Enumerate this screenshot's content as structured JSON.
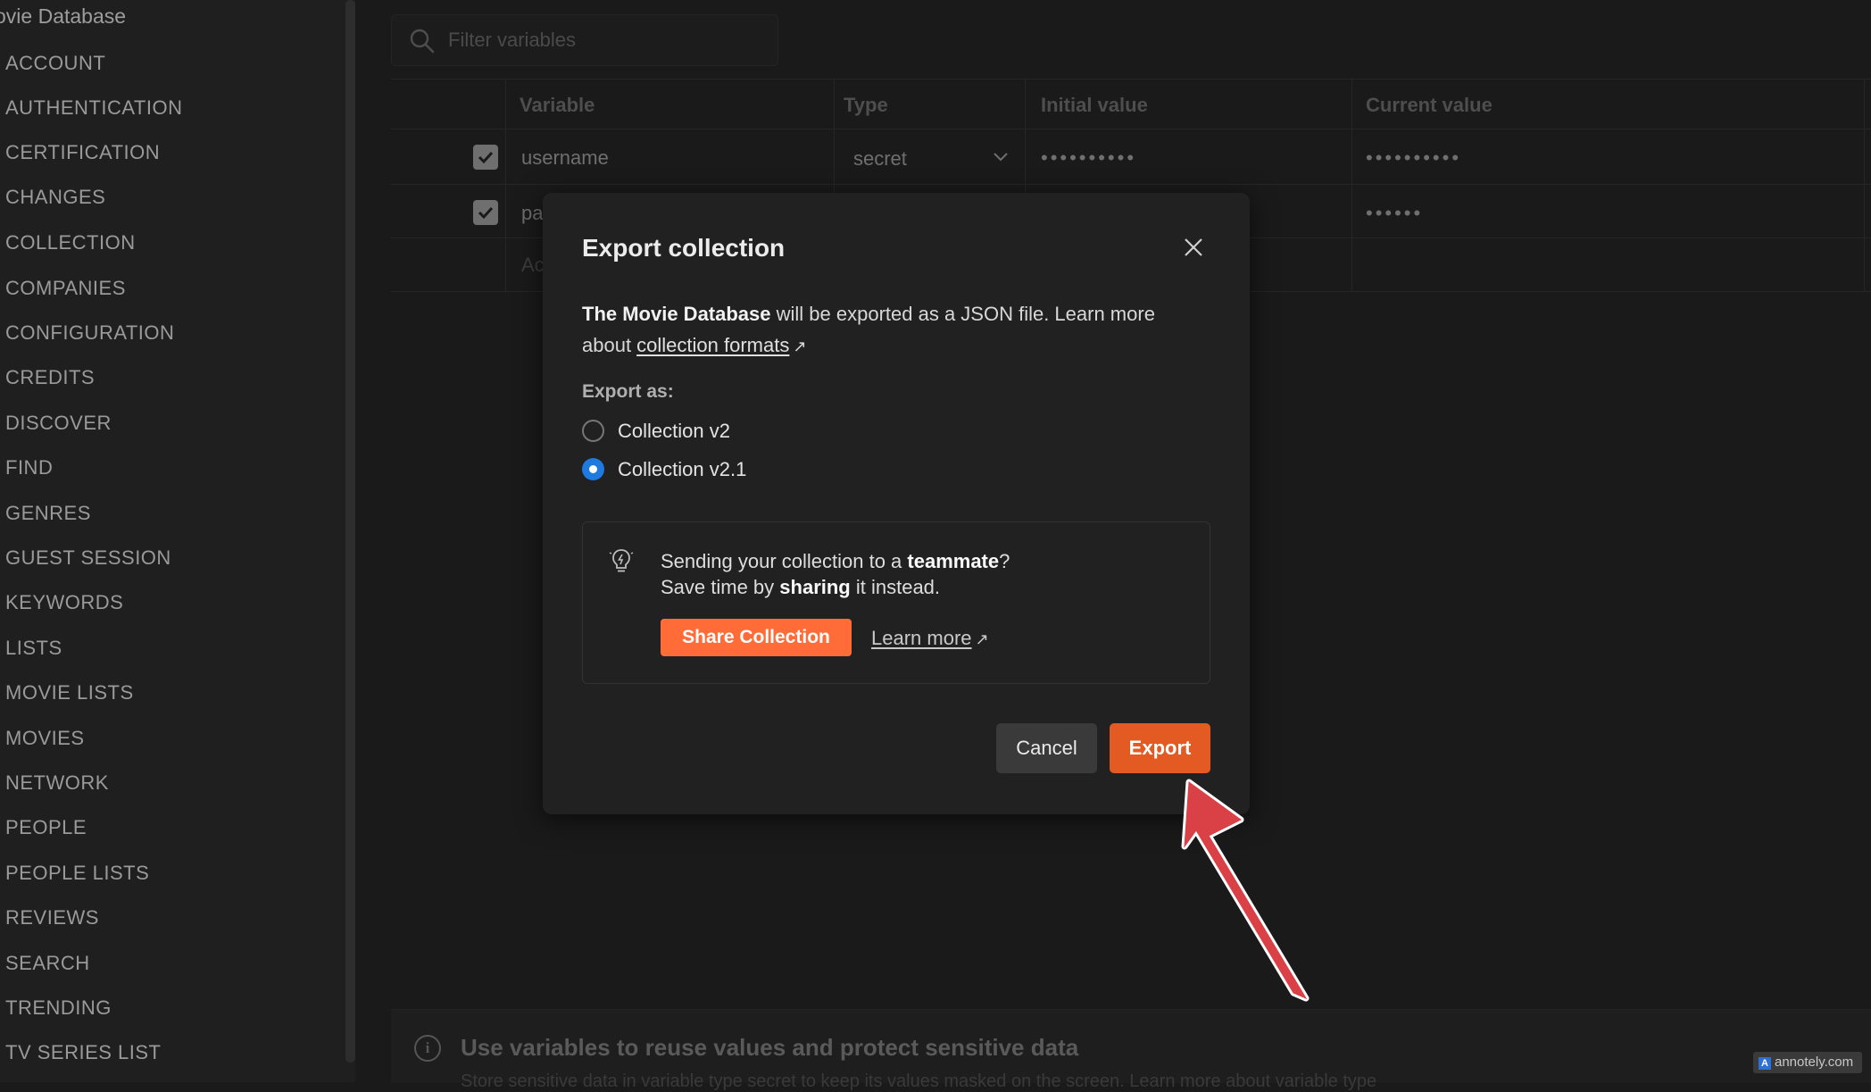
{
  "sidebar": {
    "title": "ovie Database",
    "items": [
      {
        "label": "ACCOUNT"
      },
      {
        "label": "AUTHENTICATION"
      },
      {
        "label": "CERTIFICATION"
      },
      {
        "label": "CHANGES"
      },
      {
        "label": "COLLECTION"
      },
      {
        "label": "COMPANIES"
      },
      {
        "label": "CONFIGURATION"
      },
      {
        "label": "CREDITS"
      },
      {
        "label": "DISCOVER"
      },
      {
        "label": "FIND"
      },
      {
        "label": "GENRES"
      },
      {
        "label": "GUEST SESSION"
      },
      {
        "label": "KEYWORDS"
      },
      {
        "label": "LISTS"
      },
      {
        "label": "MOVIE LISTS"
      },
      {
        "label": "MOVIES"
      },
      {
        "label": "NETWORK"
      },
      {
        "label": "PEOPLE"
      },
      {
        "label": "PEOPLE LISTS"
      },
      {
        "label": "REVIEWS"
      },
      {
        "label": "SEARCH"
      },
      {
        "label": "TRENDING"
      },
      {
        "label": "TV SERIES LIST"
      }
    ]
  },
  "filter": {
    "placeholder": "Filter variables"
  },
  "table": {
    "headers": {
      "variable": "Variable",
      "type": "Type",
      "initial": "Initial value",
      "current": "Current value"
    },
    "rows": [
      {
        "checked": true,
        "variable": "username",
        "type": "secret",
        "initial": "••••••••••",
        "current": "••••••••••"
      },
      {
        "checked": true,
        "variable": "pa",
        "type": "",
        "initial": "",
        "current": "••••••"
      }
    ],
    "add_placeholder": "Ac"
  },
  "bottom": {
    "title": "Use variables to reuse values and protect sensitive data",
    "subtitle": "Store sensitive data in variable type secret to keep its values masked on the screen. Learn more about variable type"
  },
  "modal": {
    "title": "Export collection",
    "desc_bold": "The Movie Database",
    "desc_rest": " will be exported as a JSON file. Learn more about ",
    "desc_link": "collection formats",
    "export_as_label": "Export as:",
    "options": [
      {
        "label": "Collection v2",
        "selected": false
      },
      {
        "label": "Collection v2.1",
        "selected": true
      }
    ],
    "tip": {
      "line1_pre": "Sending your collection to a ",
      "line1_bold": "teammate",
      "line1_post": "?",
      "line2_pre": "Save time by ",
      "line2_bold": "sharing",
      "line2_post": " it instead.",
      "share_label": "Share Collection",
      "learn_label": "Learn more"
    },
    "cancel_label": "Cancel",
    "export_label": "Export"
  },
  "colors": {
    "accent": "#ff6c37",
    "export": "#e35a23",
    "radio": "#1f7ae0",
    "annotation": "#e0464a"
  },
  "watermark": "annotely.com"
}
